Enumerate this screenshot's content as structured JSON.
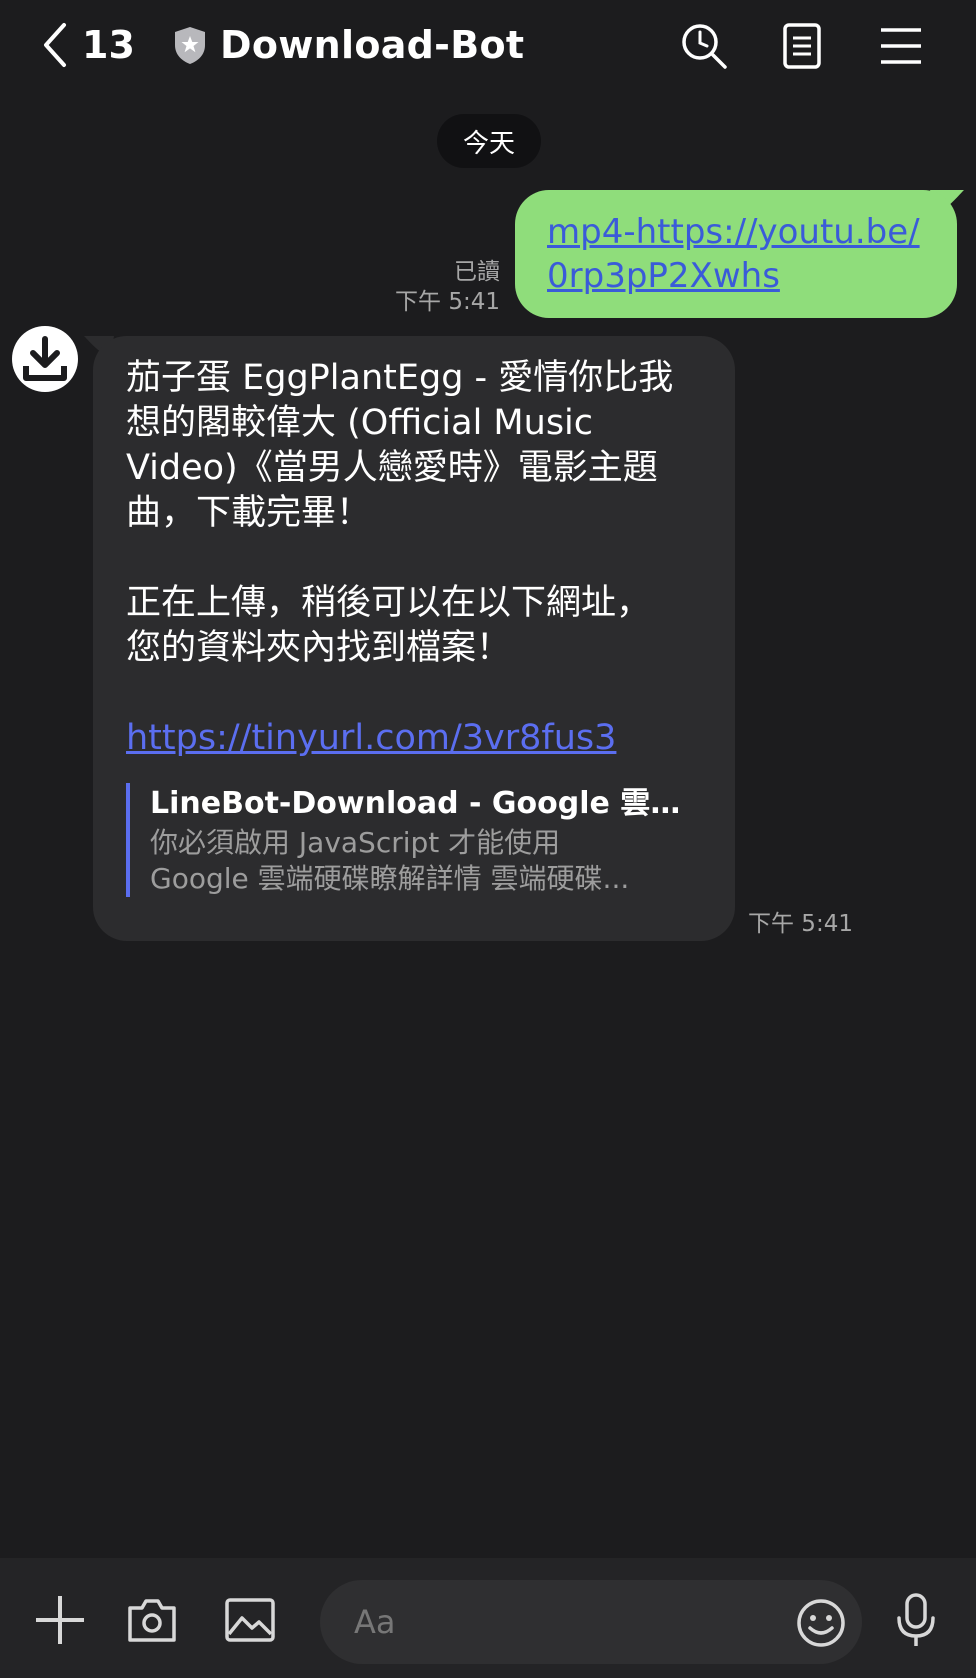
{
  "header": {
    "back_count": "13",
    "title": "Download-Bot",
    "icons": [
      "chevron-left-icon",
      "shield-icon",
      "search-icon",
      "notes-icon",
      "menu-icon"
    ]
  },
  "date_divider": "今天",
  "outgoing": {
    "text": "mp4-https://youtu.be/0rp3pP2Xwhs",
    "read_status": "已讀",
    "time": "下午 5:41"
  },
  "incoming": {
    "line1": "茄子蛋 EggPlantEgg - 愛情你比我",
    "line2": "想的閣較偉大 (Official Music",
    "line3": "Video)《當男人戀愛時》電影主題",
    "line4": "曲，下載完畢！",
    "line5": "正在上傳，稍後可以在以下網址，",
    "line6": "您的資料夾內找到檔案！",
    "link": "https://tinyurl.com/3vr8fus3",
    "preview": {
      "title": "LineBot-Download - Google 雲端...",
      "desc1": "你必須啟用 JavaScript 才能使用",
      "desc2": "Google 雲端硬碟瞭解詳情 雲端硬碟..."
    },
    "time": "下午 5:41"
  },
  "input": {
    "placeholder": "Aa"
  },
  "colors": {
    "background": "#1c1c1e",
    "outgoing_bubble": "#8fdd7b",
    "incoming_bubble": "#2c2c2e",
    "link": "#5b6ef0"
  }
}
